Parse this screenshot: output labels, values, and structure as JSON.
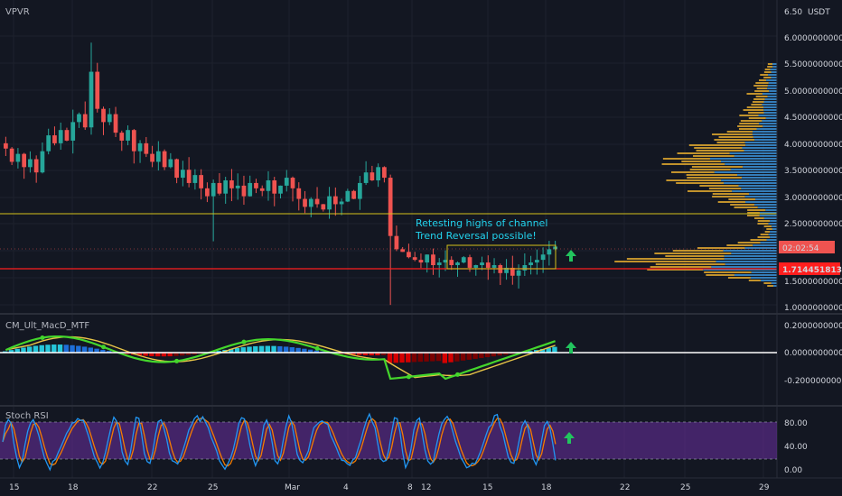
{
  "app": {
    "symbol_label": "VPVR",
    "currency": "USDT"
  },
  "main_pane": {
    "title": "VPVR",
    "price_axis": [
      "6.50",
      "6.0000000000",
      "5.5000000000",
      "5.0000000000",
      "4.5000000000",
      "4.0000000000",
      "3.5000000000",
      "3.0000000000",
      "2.5000000000",
      "1.5000000000",
      "1.0000000000"
    ],
    "timer_badge": "02:02:54",
    "price_badge": "1.7144518136",
    "annotation_line1": "Retesting highs of channel",
    "annotation_line2": "Trend Reversal possible!"
  },
  "macd_pane": {
    "title": "CM_Ult_MacD_MTF",
    "axis": [
      "0.2000000000",
      "0.0000000000",
      "-0.2000000000"
    ]
  },
  "rsi_pane": {
    "title": "Stoch RSI",
    "axis": [
      "80.00",
      "40.00",
      "0.00"
    ]
  },
  "time_axis": [
    "15",
    "18",
    "22",
    "25",
    "Mar",
    "4",
    "8",
    "12",
    "15",
    "18",
    "22",
    "25",
    "29"
  ],
  "colors": {
    "background": "#131722",
    "up": "#26a69a",
    "down": "#ef5350",
    "volume_up": "#3b8fd4",
    "volume_down": "#e0a82e",
    "channel_high": "#d4c21a",
    "support_line": "#ff1e1e",
    "rsi_band": "#6b2fa3"
  },
  "chart_data": [
    {
      "type": "candlestick",
      "title": "VPVR",
      "xlabel": "",
      "ylabel": "",
      "ylim": [
        0.9,
        6.6
      ],
      "yscale": "linear",
      "horizontal_lines": [
        {
          "name": "channel-high",
          "value": 2.72
        },
        {
          "name": "support",
          "value": 1.7144518136
        }
      ],
      "annotation": "Retesting highs of channel / Trend Reversal possible!",
      "close_series": [
        3.95,
        3.7,
        3.85,
        3.6,
        3.75,
        3.5,
        3.9,
        4.2,
        4.05,
        4.3,
        4.1,
        4.45,
        4.6,
        4.35,
        5.4,
        4.7,
        4.45,
        4.6,
        4.25,
        4.1,
        4.3,
        3.9,
        4.05,
        3.85,
        3.7,
        3.9,
        3.6,
        3.75,
        3.4,
        3.55,
        3.3,
        3.45,
        3.2,
        3.05,
        3.3,
        3.1,
        3.35,
        3.2,
        3.25,
        3.05,
        3.3,
        3.2,
        3.15,
        3.35,
        3.1,
        3.25,
        3.4,
        3.2,
        3.0,
        2.85,
        3.0,
        2.9,
        2.8,
        3.05,
        2.9,
        2.95,
        3.15,
        3.0,
        3.3,
        3.5,
        3.35,
        3.6,
        3.4,
        2.3,
        2.05,
        2.0,
        1.9,
        1.85,
        1.8,
        1.95,
        1.75,
        1.8,
        1.85,
        1.75,
        1.8,
        1.9,
        1.7,
        1.75,
        1.8,
        1.7,
        1.75,
        1.6,
        1.7,
        1.55,
        1.65,
        1.75,
        1.8,
        1.85,
        1.95,
        2.05,
        2.1
      ]
    },
    {
      "type": "line",
      "title": "CM_Ult_MacD_MTF",
      "ylim": [
        -0.32,
        0.24
      ],
      "series_names": [
        "MACD",
        "Signal"
      ],
      "note": "histogram + MACD/signal lines"
    },
    {
      "type": "line",
      "title": "Stoch RSI",
      "ylim": [
        0,
        100
      ],
      "band": [
        20,
        80
      ]
    }
  ]
}
